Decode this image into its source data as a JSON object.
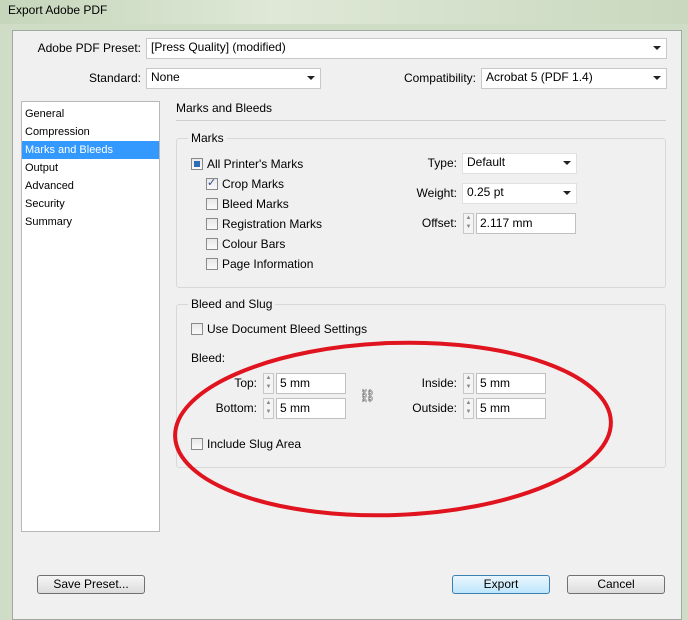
{
  "window": {
    "title": "Export Adobe PDF"
  },
  "top": {
    "preset_label": "Adobe PDF Preset:",
    "preset_value": "[Press Quality] (modified)",
    "standard_label": "Standard:",
    "standard_value": "None",
    "compat_label": "Compatibility:",
    "compat_value": "Acrobat 5 (PDF 1.4)"
  },
  "sidebar": {
    "items": [
      {
        "label": "General"
      },
      {
        "label": "Compression"
      },
      {
        "label": "Marks and Bleeds"
      },
      {
        "label": "Output"
      },
      {
        "label": "Advanced"
      },
      {
        "label": "Security"
      },
      {
        "label": "Summary"
      }
    ],
    "selected": "Marks and Bleeds"
  },
  "section_title": "Marks and Bleeds",
  "marks": {
    "legend": "Marks",
    "all": "All Printer's Marks",
    "crop": "Crop Marks",
    "bleed": "Bleed Marks",
    "registration": "Registration Marks",
    "colour": "Colour Bars",
    "page_info": "Page Information",
    "type_label": "Type:",
    "type_value": "Default",
    "weight_label": "Weight:",
    "weight_value": "0.25 pt",
    "offset_label": "Offset:",
    "offset_value": "2.117 mm",
    "crop_checked": true,
    "all_indeterminate": true
  },
  "bleed": {
    "legend": "Bleed and Slug",
    "use_doc": "Use Document Bleed Settings",
    "bleed_label": "Bleed:",
    "top_label": "Top:",
    "top_value": "5 mm",
    "bottom_label": "Bottom:",
    "bottom_value": "5 mm",
    "inside_label": "Inside:",
    "inside_value": "5 mm",
    "outside_label": "Outside:",
    "outside_value": "5 mm",
    "slug": "Include Slug Area"
  },
  "buttons": {
    "save_preset": "Save Preset...",
    "export": "Export",
    "cancel": "Cancel"
  },
  "annotation_color": "#e0141e"
}
